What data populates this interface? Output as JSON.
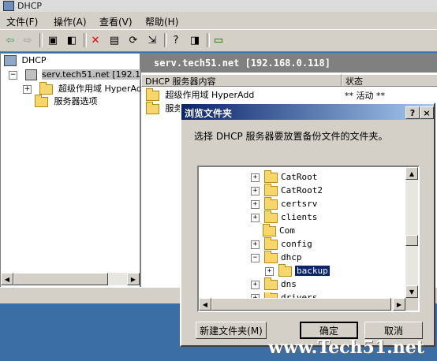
{
  "window": {
    "title": "DHCP"
  },
  "menu": {
    "file": "文件(F)",
    "action": "操作(A)",
    "view": "查看(V)",
    "help": "帮助(H)"
  },
  "tree": {
    "root": "DHCP",
    "server": "serv.tech51.net [192.1",
    "superscope": "超级作用域 HyperAd",
    "server_options": "服务器选项"
  },
  "details": {
    "header": "serv.tech51.net [192.168.0.118]",
    "col_content": "DHCP 服务器内容",
    "col_status": "状态",
    "rows": [
      {
        "name": "超级作用域 HyperAdd",
        "status": "** 活动 **"
      },
      {
        "name": "服务器选项",
        "status": ""
      }
    ]
  },
  "dialog": {
    "title": "浏览文件夹",
    "help_btn": "?",
    "close_btn": "×",
    "instruction": "选择 DHCP 服务器要放置备份文件的文件夹。",
    "folders": [
      "CatRoot",
      "CatRoot2",
      "certsrv",
      "clients",
      "Com",
      "config",
      "dhcp",
      "backup",
      "dns",
      "drivers"
    ],
    "selected": "backup",
    "new_folder": "新建文件夹(M)",
    "ok": "确定",
    "cancel": "取消"
  },
  "watermark": "www.Tech51.net"
}
